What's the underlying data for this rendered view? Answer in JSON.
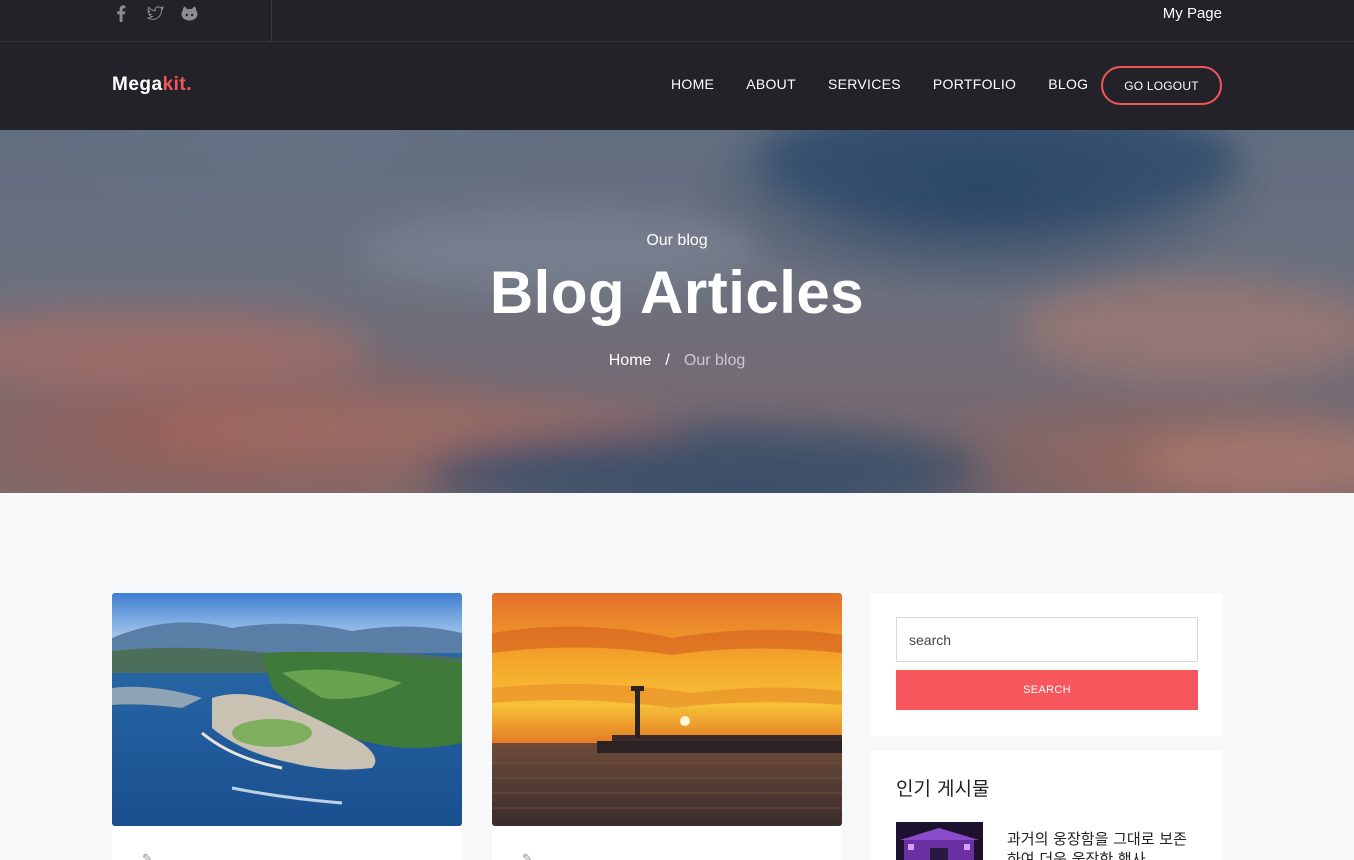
{
  "topbar": {
    "socials": [
      {
        "icon": "facebook-icon"
      },
      {
        "icon": "twitter-icon"
      },
      {
        "icon": "github-icon"
      }
    ],
    "my_page": "My Page"
  },
  "navbar": {
    "logo_main": "Mega",
    "logo_accent": "kit.",
    "items": [
      "HOME",
      "ABOUT",
      "SERVICES",
      "PORTFOLIO",
      "BLOG"
    ],
    "logout": "GO LOGOUT",
    "accent_color": "#f2565b",
    "background": "#232229"
  },
  "hero": {
    "subtitle": "Our blog",
    "title": "Blog Articles",
    "breadcrumb_home": "Home",
    "breadcrumb_sep": "/",
    "breadcrumb_current": "Our blog"
  },
  "posts": [
    {
      "image": "coastal-town-aerial-photo"
    },
    {
      "image": "sunset-pier-photo"
    }
  ],
  "sidebar": {
    "search_placeholder": "search",
    "search_button": "SEARCH",
    "search_button_color": "#f7575c",
    "popular_heading": "인기 게시물",
    "popular_posts": [
      {
        "title": "과거의 웅장함을 그대로 보존하여 더욱 웅장한 행사"
      }
    ]
  }
}
